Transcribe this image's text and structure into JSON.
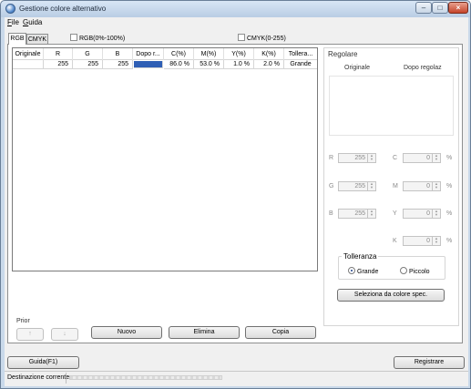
{
  "window": {
    "title": "Gestione colore alternativo"
  },
  "menu": {
    "file": "File",
    "file_u": "F",
    "file_rest": "ile",
    "guida": "Guida",
    "guida_u": "G",
    "guida_rest": "uida"
  },
  "tabs": {
    "rgb": "RGB",
    "cmyk": "CMYK"
  },
  "checks": {
    "rgb_percent": "RGB(0%-100%)",
    "cmyk_range": "CMYK(0-255)"
  },
  "table": {
    "headers": [
      "Originale",
      "R",
      "G",
      "B",
      "Dopo r...",
      "C(%)",
      "M(%)",
      "Y(%)",
      "K(%)",
      "Tollera..."
    ],
    "rows": [
      {
        "originale": "",
        "r": "255",
        "g": "255",
        "b": "255",
        "after_color": "#2f5fb5",
        "c": "86.0 %",
        "m": "53.0 %",
        "y": "1.0 %",
        "k": "2.0 %",
        "tolleranza": "Grande"
      }
    ]
  },
  "regolare": {
    "title": "Regolare",
    "col_originale": "Originale",
    "col_dopo": "Dopo regolaz",
    "r_label": "R",
    "r_value": "255",
    "g_label": "G",
    "g_value": "255",
    "b_label": "B",
    "b_value": "255",
    "c_label": "C",
    "c_value": "0",
    "m_label": "M",
    "m_value": "0",
    "y_label": "Y",
    "y_value": "0",
    "k_label": "K",
    "k_value": "0",
    "pct": "%"
  },
  "tolleranza": {
    "title": "Tolleranza",
    "grande": "Grande",
    "piccolo": "Piccolo",
    "selected": "Grande"
  },
  "buttons": {
    "seleziona": "Seleziona da colore spec.",
    "nuovo": "Nuovo",
    "elimina": "Elimina",
    "copia": "Copia",
    "up": "↑",
    "down": "↓",
    "guida": "Guida(F1)",
    "registrare": "Registrare"
  },
  "prior": {
    "label": "Prior"
  },
  "status": {
    "text": "Destinazione corrente"
  }
}
